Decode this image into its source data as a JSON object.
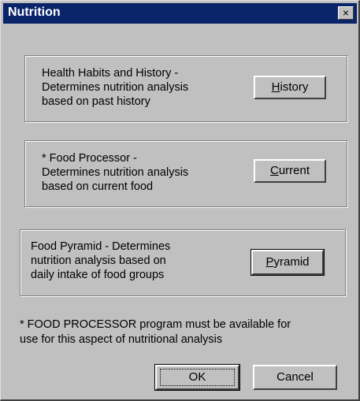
{
  "window": {
    "title": "Nutrition",
    "close_label": "×"
  },
  "sections": [
    {
      "description": "Health Habits and History -\nDetermines nutrition analysis\nbased on past history",
      "button_mnemonic": "H",
      "button_rest": "istory"
    },
    {
      "description": "* Food Processor -\nDetermines nutrition analysis\nbased on current food",
      "button_mnemonic": "C",
      "button_rest": "urrent"
    },
    {
      "description": "Food Pyramid - Determines\nnutrition analysis based on\ndaily intake of food groups",
      "button_mnemonic": "P",
      "button_rest": "yramid"
    }
  ],
  "footnote": "* FOOD PROCESSOR program must be available for\nuse for this aspect of nutritional analysis",
  "buttons": {
    "ok_label": "OK",
    "cancel_label": "Cancel"
  },
  "colors": {
    "titlebar": "#0a246a",
    "face": "#c0c0c0"
  }
}
